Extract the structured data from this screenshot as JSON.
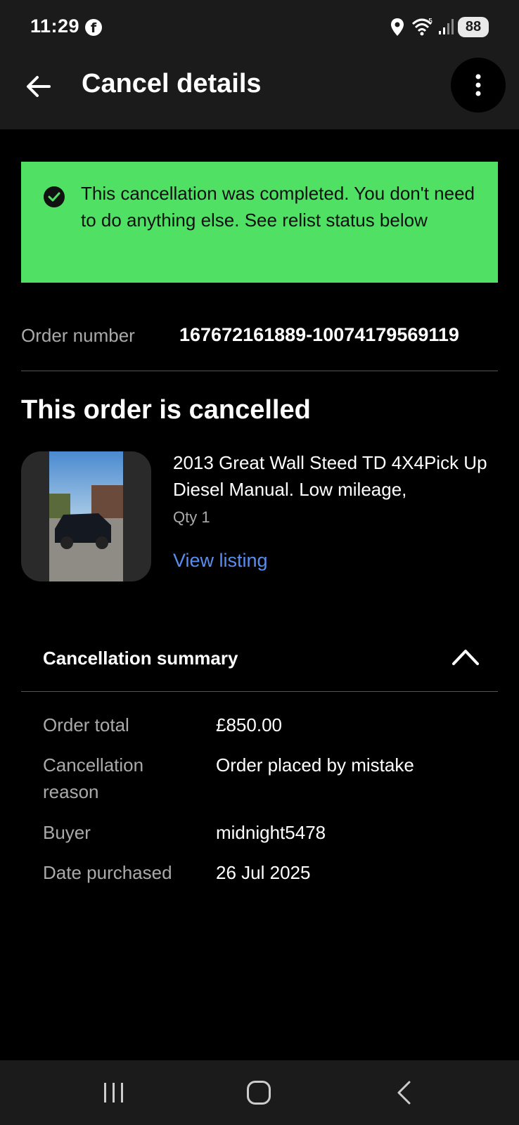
{
  "status_bar": {
    "time": "11:29",
    "facebook_glyph": "f",
    "battery": "88"
  },
  "app_bar": {
    "title": "Cancel details"
  },
  "banner": {
    "message": "This cancellation was completed. You don't need to do anything else. See relist status below",
    "color": "#4fe064"
  },
  "order": {
    "number_label": "Order number",
    "number_value": "167672161889-10074179569119"
  },
  "main": {
    "section_title": "This order is cancelled"
  },
  "item": {
    "title": "2013 Great Wall Steed TD 4X4Pick Up Diesel Manual. Low mileage,",
    "qty": "Qty 1",
    "view_listing": "View listing",
    "link_color": "#5a8df0"
  },
  "summary": {
    "title": "Cancellation summary",
    "rows": [
      {
        "label": "Order total",
        "value": "£850.00"
      },
      {
        "label": "Cancellation reason",
        "value": "Order placed by mistake"
      },
      {
        "label": "Buyer",
        "value": "midnight5478"
      },
      {
        "label": "Date purchased",
        "value": "26 Jul 2025"
      }
    ]
  },
  "icons": [
    "facebook-icon",
    "location-icon",
    "wifi-icon",
    "signal-icon",
    "back-arrow-icon",
    "more-vertical-icon",
    "check-circle-icon",
    "chevron-up-icon",
    "nav-recents-icon",
    "nav-home-icon",
    "nav-back-icon"
  ]
}
